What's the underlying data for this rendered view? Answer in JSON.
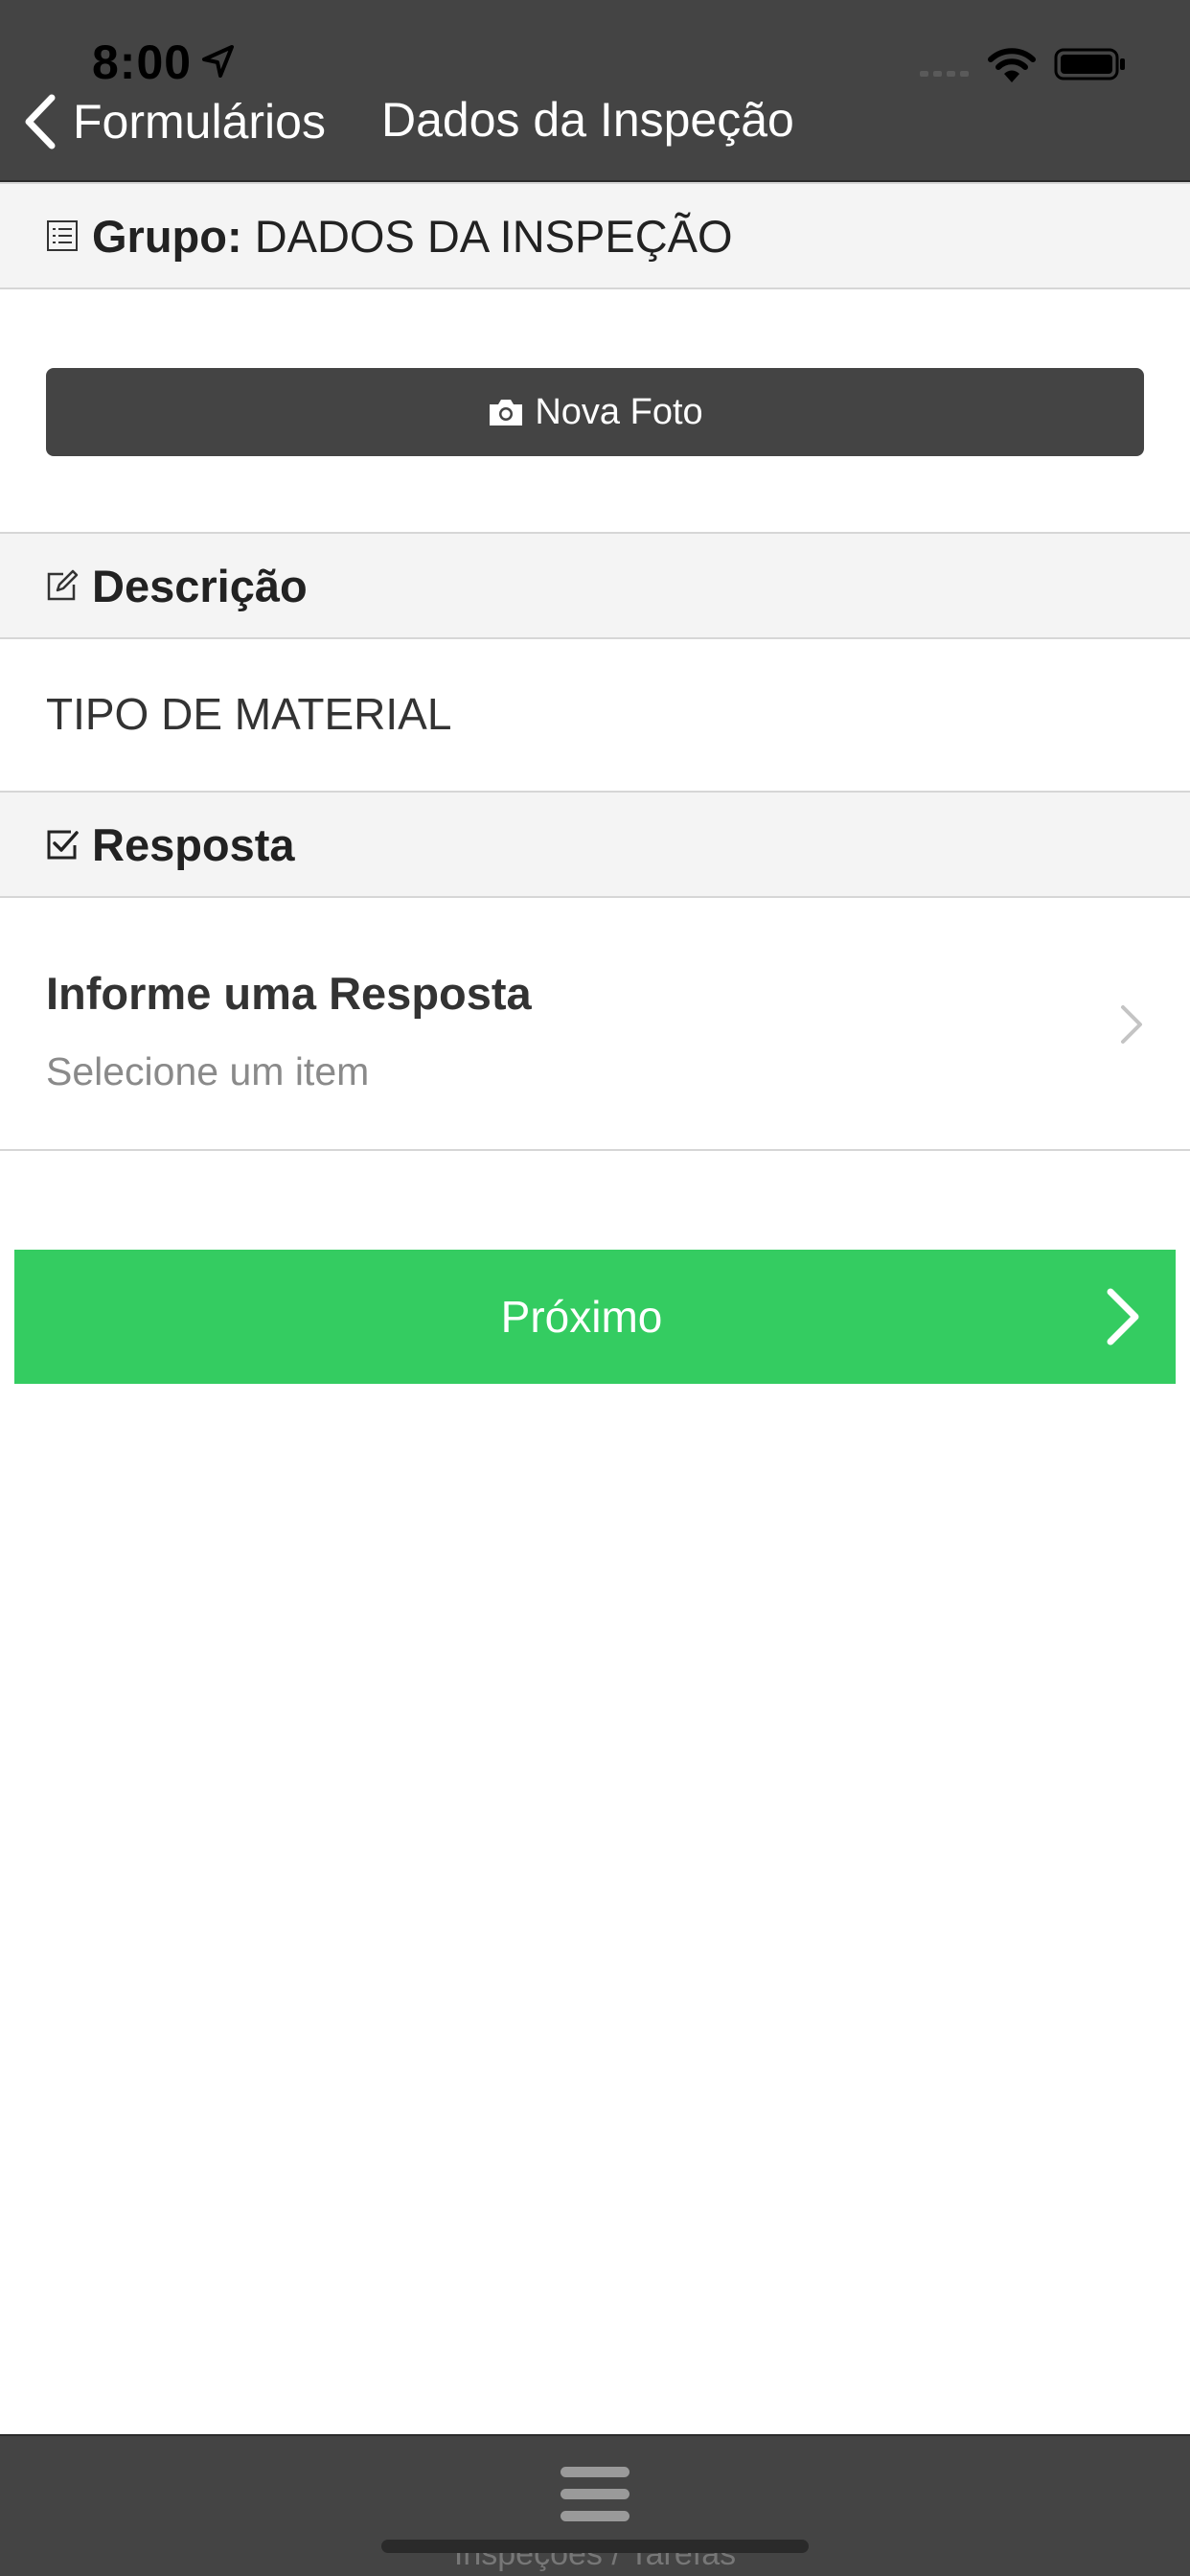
{
  "status_bar": {
    "time": "8:00",
    "location_icon": "location-arrow-icon",
    "signal_icon": "cellular-signal-icon",
    "wifi_icon": "wifi-icon",
    "battery_icon": "battery-icon"
  },
  "nav": {
    "back_label": "Formulários",
    "title": "Dados da Inspeção"
  },
  "group": {
    "icon": "list-icon",
    "label": "Grupo:",
    "value": "DADOS DA INSPEÇÃO"
  },
  "photo_button": {
    "icon": "camera-icon",
    "label": "Nova Foto"
  },
  "description": {
    "icon": "edit-icon",
    "title": "Descrição",
    "value": "TIPO DE MATERIAL"
  },
  "response": {
    "icon": "checkbox-icon",
    "title": "Resposta",
    "field_label": "Informe uma Resposta",
    "placeholder": "Selecione um item"
  },
  "next_button": {
    "label": "Próximo"
  },
  "bottom_bar": {
    "menu_icon": "hamburger-menu-icon",
    "tab_label": "Inspeções / Tarefas"
  },
  "colors": {
    "header": "#444444",
    "accent_green": "#34cc61",
    "section_bg": "#f4f4f4"
  }
}
